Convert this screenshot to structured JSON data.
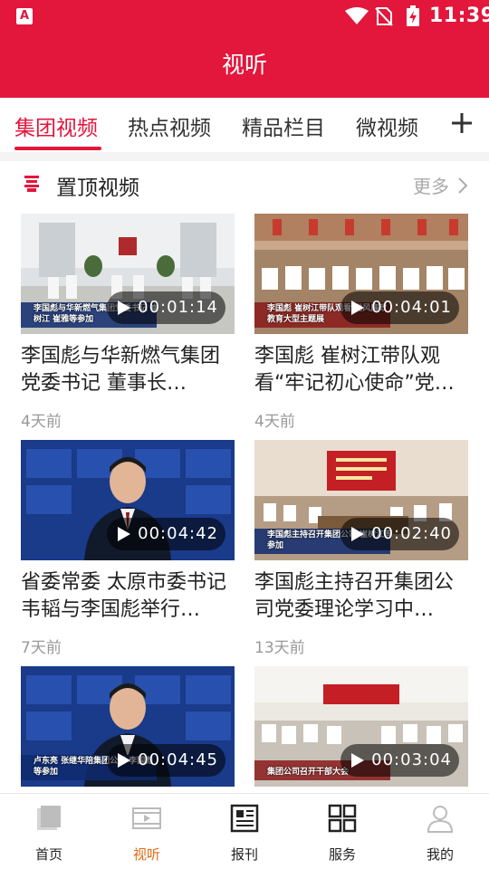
{
  "status_bar": {
    "app_badge": "A",
    "time": "11:39"
  },
  "header": {
    "title": "视听"
  },
  "tabs": [
    {
      "label": "集团视频",
      "active": true
    },
    {
      "label": "热点视频",
      "active": false
    },
    {
      "label": "精品栏目",
      "active": false
    },
    {
      "label": "微视频",
      "active": false
    }
  ],
  "tabs_add_icon": "plus-icon",
  "section": {
    "title": "置顶视频",
    "more_label": "更多",
    "logo_icon": "seal-icon"
  },
  "videos": [
    {
      "title": "李国彪与华新燃气集团党委书记 董事长…",
      "duration": "00:01:14",
      "time": "4天前",
      "caption": "李国彪与华新燃气集团党委书记 崔树江 崔雅等参加"
    },
    {
      "title": "李国彪 崔树江带队观看“牢记初心使命”党…",
      "duration": "00:04:01",
      "time": "4天前",
      "caption": "李国彪 崔树江带队观看 党风廉政教育大型主题展"
    },
    {
      "title": "省委常委 太原市委书记韦韬与李国彪举行…",
      "duration": "00:04:42",
      "time": "7天前",
      "caption": ""
    },
    {
      "title": "李国彪主持召开集团公司党委理论学习中…",
      "duration": "00:02:40",
      "time": "13天前",
      "caption": "李国彪主持召开集团公司 崔树江等参加"
    },
    {
      "title": "",
      "duration": "00:04:45",
      "time": "",
      "caption": "卢东亮 张继华陪集团公司 李国彪等参加"
    },
    {
      "title": "",
      "duration": "00:03:04",
      "time": "",
      "caption": "集团公司召开干部大会"
    }
  ],
  "bottom_nav": [
    {
      "label": "首页",
      "icon": "home-icon",
      "active": false
    },
    {
      "label": "视听",
      "icon": "video-icon",
      "active": true
    },
    {
      "label": "报刊",
      "icon": "newspaper-icon",
      "active": false
    },
    {
      "label": "服务",
      "icon": "grid-icon",
      "active": false
    },
    {
      "label": "我的",
      "icon": "profile-icon",
      "active": false
    }
  ],
  "colors": {
    "brand_red": "#e3163c",
    "active_nav": "#e36a14",
    "muted": "#999999"
  }
}
